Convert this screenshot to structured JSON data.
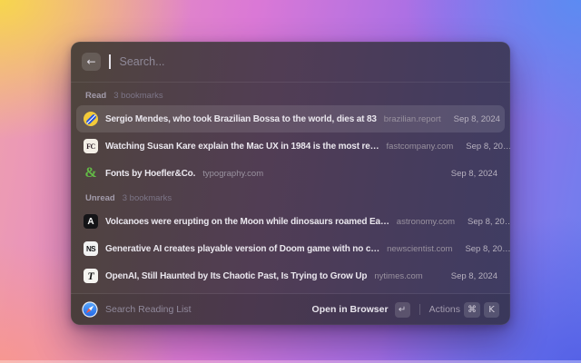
{
  "window": {
    "search": {
      "placeholder": "Search...",
      "back_icon": "←"
    },
    "sections": [
      {
        "label": "Read",
        "count": "3 bookmarks",
        "items": [
          {
            "title": "Sergio Mendes, who took Brazilian Bossa to the world, dies at 83",
            "domain": "brazilian.report",
            "date": "Sep 8, 2024",
            "selected": true,
            "icon": "brazilian-report-favicon",
            "icon_kind": "brazil"
          },
          {
            "title": "Watching Susan Kare explain the Mac UX in 1984 is the most re…",
            "domain": "fastcompany.com",
            "date": "Sep 8, 20…",
            "selected": false,
            "icon": "fastcompany-favicon",
            "icon_kind": "letter",
            "icon_text": "FC",
            "icon_bg": "#f4efe7",
            "icon_fg": "#30222b",
            "icon_font": "serif"
          },
          {
            "title": "Fonts by Hoefler&Co.",
            "domain": "typography.com",
            "date": "Sep 8, 2024",
            "selected": false,
            "icon": "hoefler-ampersand-favicon",
            "icon_kind": "letter",
            "icon_text": "&",
            "icon_bg": "transparent",
            "icon_fg": "#63bb46",
            "icon_font": "serif-big"
          }
        ]
      },
      {
        "label": "Unread",
        "count": "3 bookmarks",
        "items": [
          {
            "title": "Volcanoes were erupting on the Moon while dinosaurs roamed Ea…",
            "domain": "astronomy.com",
            "date": "Sep 8, 20…",
            "selected": false,
            "icon": "astronomy-favicon",
            "icon_kind": "letter",
            "icon_text": "A",
            "icon_bg": "#141417",
            "icon_fg": "#ffffff",
            "icon_font": "sans"
          },
          {
            "title": "Generative AI creates playable version of Doom game with no c…",
            "domain": "newscientist.com",
            "date": "Sep 8, 20…",
            "selected": false,
            "icon": "newscientist-favicon",
            "icon_kind": "letter",
            "icon_text": "NS",
            "icon_bg": "#f2f2f2",
            "icon_fg": "#141417",
            "icon_font": "sans-narrow"
          },
          {
            "title": "OpenAI, Still Haunted by Its Chaotic Past, Is Trying to Grow Up",
            "domain": "nytimes.com",
            "date": "Sep 8, 2024",
            "selected": false,
            "icon": "nytimes-favicon",
            "icon_kind": "letter",
            "icon_text": "T",
            "icon_bg": "#f6f5f1",
            "icon_fg": "#121212",
            "icon_font": "blackletter"
          }
        ]
      }
    ],
    "footer": {
      "app_icon": "safari-compass-icon",
      "app_label": "Search Reading List",
      "primary_action": "Open in Browser",
      "primary_key": "↵",
      "actions_label": "Actions",
      "actions_keys": [
        "⌘",
        "K"
      ]
    },
    "colors": {
      "selection_highlight": "#5e5669",
      "hoefler_green": "#63bb46",
      "brazil_yellow": "#f2ca3a",
      "brazil_blue": "#2553dd"
    }
  }
}
